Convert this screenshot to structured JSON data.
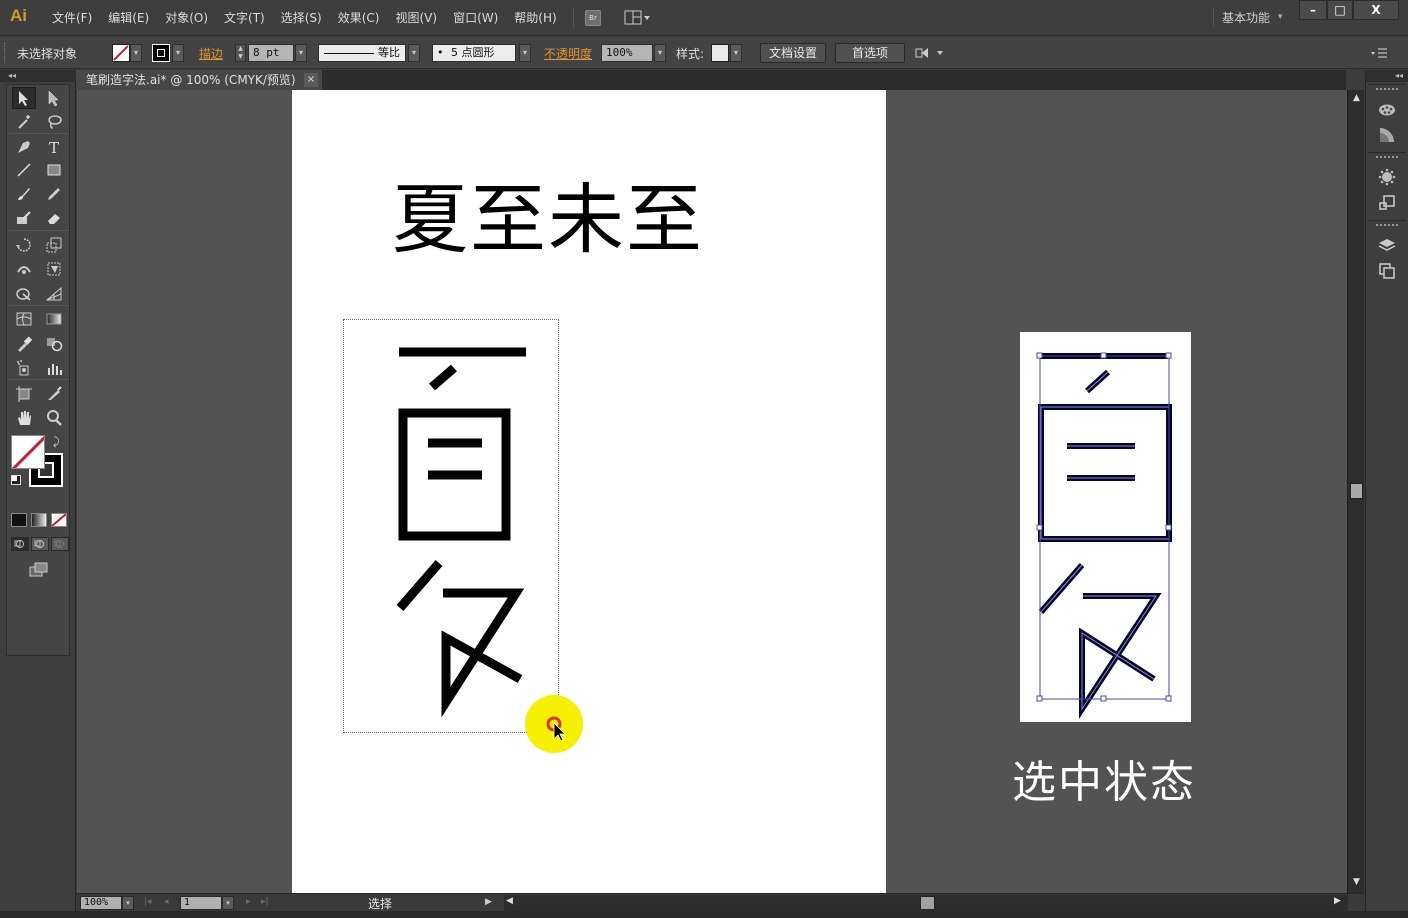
{
  "app": {
    "logo": "Ai",
    "menu": [
      "文件(F)",
      "编辑(E)",
      "对象(O)",
      "文字(T)",
      "选择(S)",
      "效果(C)",
      "视图(V)",
      "窗口(W)",
      "帮助(H)"
    ],
    "bridge_label": "Br",
    "workspace": "基本功能",
    "workspace_arrow": "▾",
    "window_controls": {
      "minimize": "–",
      "maximize": "□",
      "close": "X"
    }
  },
  "control_bar": {
    "selection_status": "未选择对象",
    "stroke_label": "描边",
    "stroke_weight": "8 pt",
    "stroke_profile": "等比",
    "brush": "5 点圆形",
    "brush_dot": "•",
    "opacity_label": "不透明度",
    "opacity": "100%",
    "style_label": "样式:",
    "doc_setup_button": "文档设置",
    "preferences_button": "首选项",
    "dropdown_arrow": "▾"
  },
  "document_tab": {
    "title": "笔刷造字法.ai* @ 100% (CMYK/预览)",
    "close": "×"
  },
  "panel_collapse": "◂◂",
  "artboard": {
    "headline": "夏至未至",
    "caption": "选中状态"
  },
  "colors": {
    "fill": "none",
    "stroke": "#000000",
    "highlight": "#f5f000",
    "selection": "#4a4aa8"
  },
  "status_bar": {
    "zoom": "100%",
    "artboard_number": "1",
    "current_tool": "选择",
    "nav_first": "|◂",
    "nav_prev": "◂",
    "nav_next": "▸",
    "nav_last": "▸|",
    "play": "▶",
    "back": "◀"
  },
  "scroll": {
    "up": "▲",
    "down": "▼",
    "left": "◀",
    "right": "▶"
  },
  "tools": [
    "selection",
    "direct-selection",
    "magic-wand",
    "lasso",
    "pen",
    "type",
    "line-segment",
    "rectangle",
    "paintbrush",
    "pencil",
    "blob-brush",
    "eraser",
    "rotate",
    "scale",
    "warp",
    "free-transform",
    "shape-builder",
    "perspective-grid",
    "mesh",
    "gradient",
    "eyedropper",
    "blend",
    "symbol-sprayer",
    "column-graph",
    "artboard",
    "slice",
    "hand",
    "zoom"
  ],
  "dock_panels": [
    "color",
    "color-guide",
    "symbols",
    "transform",
    "layers",
    "artboards"
  ]
}
